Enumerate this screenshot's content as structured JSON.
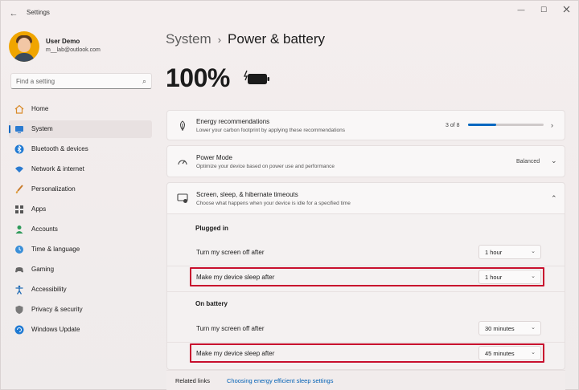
{
  "window": {
    "title": "Settings",
    "back_glyph": "←",
    "minimize_glyph": "—",
    "maximize_glyph": "☐"
  },
  "profile": {
    "name": "User Demo",
    "email": "m__lab@outlook.com"
  },
  "search": {
    "placeholder": "Find a setting",
    "icon": "search-icon",
    "icon_glyph": "⌕"
  },
  "sidebar": {
    "items": [
      {
        "label": "Home",
        "icon": "home-icon"
      },
      {
        "label": "System",
        "icon": "system-icon",
        "active": true
      },
      {
        "label": "Bluetooth & devices",
        "icon": "bluetooth-icon"
      },
      {
        "label": "Network & internet",
        "icon": "wifi-icon"
      },
      {
        "label": "Personalization",
        "icon": "brush-icon"
      },
      {
        "label": "Apps",
        "icon": "apps-icon"
      },
      {
        "label": "Accounts",
        "icon": "person-icon"
      },
      {
        "label": "Time & language",
        "icon": "globe-clock-icon"
      },
      {
        "label": "Gaming",
        "icon": "gamepad-icon"
      },
      {
        "label": "Accessibility",
        "icon": "accessibility-icon"
      },
      {
        "label": "Privacy & security",
        "icon": "shield-icon"
      },
      {
        "label": "Windows Update",
        "icon": "update-icon"
      }
    ]
  },
  "breadcrumb": {
    "parent": "System",
    "separator": "›",
    "current": "Power & battery"
  },
  "battery": {
    "percent_text": "100%",
    "icon": "battery-charging-icon"
  },
  "energy": {
    "title": "Energy recommendations",
    "subtitle": "Lower your carbon footprint by applying these recommendations",
    "progress_text": "3 of 8",
    "progress_fraction": 0.375,
    "chevron": "›"
  },
  "power_mode": {
    "title": "Power Mode",
    "subtitle": "Optimize your device based on power use and performance",
    "value": "Balanced",
    "chevron": "⌄"
  },
  "timeouts": {
    "title": "Screen, sleep, & hibernate timeouts",
    "subtitle": "Choose what happens when your device is idle for a specified time",
    "chevron": "⌃",
    "dropdown_glyph": "⌄",
    "plugged_in": {
      "heading": "Plugged in",
      "screen_off_label": "Turn my screen off after",
      "screen_off_value": "1 hour",
      "sleep_label": "Make my device sleep after",
      "sleep_value": "1 hour"
    },
    "on_battery": {
      "heading": "On battery",
      "screen_off_label": "Turn my screen off after",
      "screen_off_value": "30 minutes",
      "sleep_label": "Make my device sleep after",
      "sleep_value": "45 minutes"
    }
  },
  "related": {
    "label": "Related links",
    "link": "Choosing energy efficient sleep settings"
  },
  "colors": {
    "accent": "#0067c0",
    "highlight": "#c8102e",
    "link": "#0060b5"
  }
}
